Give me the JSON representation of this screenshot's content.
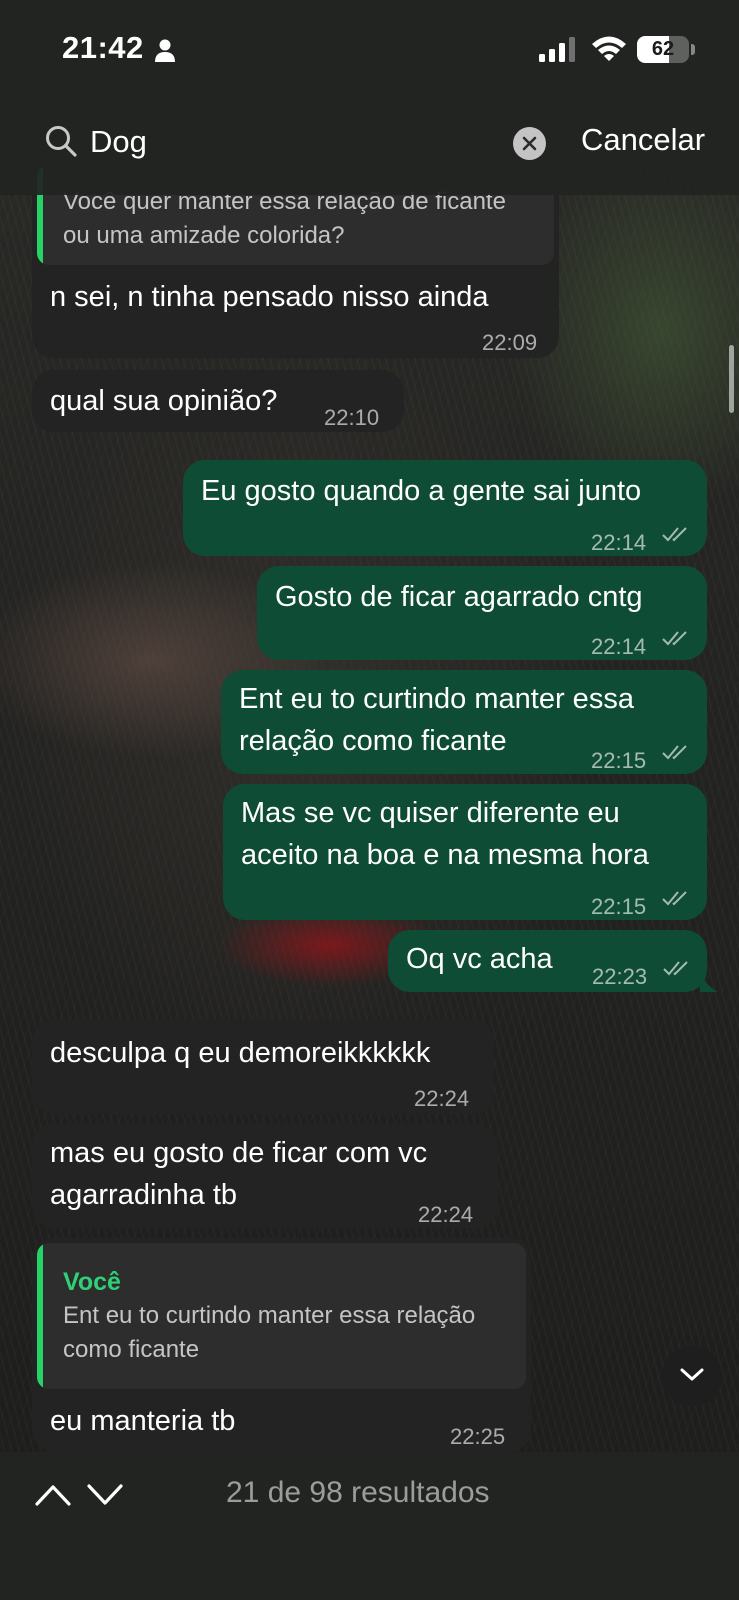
{
  "status_bar": {
    "time": "21:42",
    "battery_level": "62",
    "battery_fraction": 0.62
  },
  "search": {
    "query": "Dog",
    "cancel_label": "Cancelar"
  },
  "messages": [
    {
      "direction": "incoming",
      "quote": {
        "text": "Você quer manter essa relação de ficante\nou uma amizade colorida?"
      },
      "text": "n sei, n tinha pensado nisso ainda",
      "time": "22:09"
    },
    {
      "direction": "incoming",
      "text": "qual sua opinião?",
      "time": "22:10"
    },
    {
      "direction": "outgoing",
      "text": "Eu gosto quando a gente sai junto",
      "time": "22:14",
      "status": "read"
    },
    {
      "direction": "outgoing",
      "text": "Gosto de ficar agarrado cntg",
      "time": "22:14",
      "status": "read"
    },
    {
      "direction": "outgoing",
      "text": "Ent eu to curtindo manter essa\nrelação como ficante",
      "time": "22:15",
      "status": "read"
    },
    {
      "direction": "outgoing",
      "text": "Mas se vc quiser diferente eu\naceito na boa e na mesma hora",
      "time": "22:15",
      "status": "read"
    },
    {
      "direction": "outgoing",
      "text": "Oq vc acha",
      "time": "22:23",
      "status": "read"
    },
    {
      "direction": "incoming",
      "text": "desculpa q eu demoreikkkkkk",
      "time": "22:24"
    },
    {
      "direction": "incoming",
      "text": "mas eu gosto de ficar com vc\nagarradinha tb",
      "time": "22:24"
    },
    {
      "direction": "incoming",
      "quote": {
        "author": "Você",
        "text": "Ent eu to curtindo manter essa relação\ncomo ficante"
      },
      "text": "eu manteria tb",
      "time": "22:25"
    }
  ],
  "results": {
    "label": "21 de 98 resultados"
  },
  "icons": {
    "person": "person-icon",
    "signal": "signal-icon",
    "wifi": "wifi-icon",
    "search": "search-icon",
    "clear": "close-icon",
    "read_receipt": "double-check-icon",
    "scroll_down": "chevron-down-icon",
    "nav_up": "chevron-up-icon",
    "nav_down": "chevron-down-icon"
  },
  "colors": {
    "outgoing_bubble": "#0f4c35",
    "incoming_bubble": "#222322",
    "quote_accent": "#25d366",
    "quote_author": "#2fd076"
  }
}
